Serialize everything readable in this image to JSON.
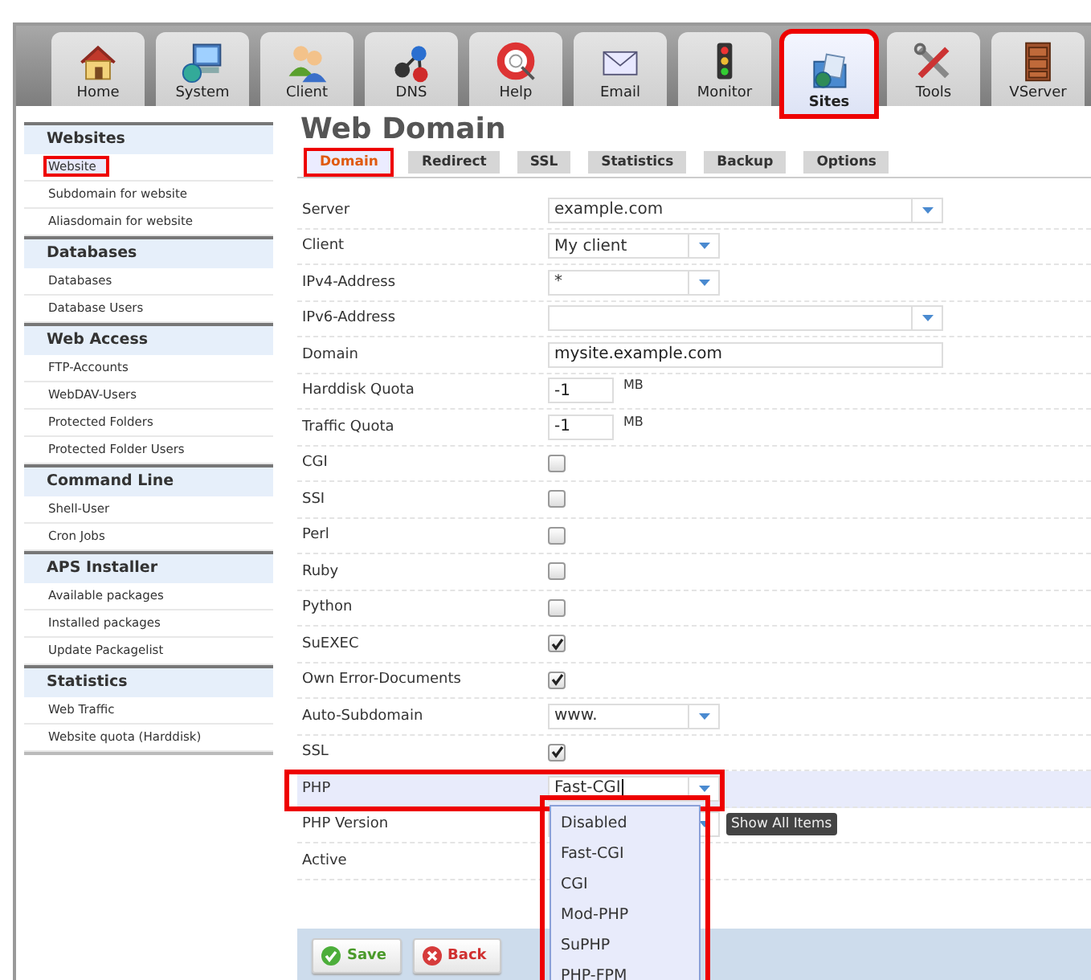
{
  "nav": [
    {
      "label": "Home",
      "selected": false,
      "highlighted": false
    },
    {
      "label": "System",
      "selected": false,
      "highlighted": false
    },
    {
      "label": "Client",
      "selected": false,
      "highlighted": false
    },
    {
      "label": "DNS",
      "selected": false,
      "highlighted": false
    },
    {
      "label": "Help",
      "selected": false,
      "highlighted": false
    },
    {
      "label": "Email",
      "selected": false,
      "highlighted": false
    },
    {
      "label": "Monitor",
      "selected": false,
      "highlighted": false
    },
    {
      "label": "Sites",
      "selected": true,
      "highlighted": true
    },
    {
      "label": "Tools",
      "selected": false,
      "highlighted": false
    },
    {
      "label": "VServer",
      "selected": false,
      "highlighted": false
    }
  ],
  "sidebar": [
    {
      "title": "Websites",
      "items": [
        {
          "label": "Website",
          "selected": true,
          "highlighted": true
        },
        {
          "label": "Subdomain for website",
          "selected": false,
          "highlighted": false
        },
        {
          "label": "Aliasdomain for website",
          "selected": false,
          "highlighted": false
        }
      ]
    },
    {
      "title": "Databases",
      "items": [
        {
          "label": "Databases",
          "selected": false,
          "highlighted": false
        },
        {
          "label": "Database Users",
          "selected": false,
          "highlighted": false
        }
      ]
    },
    {
      "title": "Web Access",
      "items": [
        {
          "label": "FTP-Accounts",
          "selected": false,
          "highlighted": false
        },
        {
          "label": "WebDAV-Users",
          "selected": false,
          "highlighted": false
        },
        {
          "label": "Protected Folders",
          "selected": false,
          "highlighted": false
        },
        {
          "label": "Protected Folder Users",
          "selected": false,
          "highlighted": false
        }
      ]
    },
    {
      "title": "Command Line",
      "items": [
        {
          "label": "Shell-User",
          "selected": false,
          "highlighted": false
        },
        {
          "label": "Cron Jobs",
          "selected": false,
          "highlighted": false
        }
      ]
    },
    {
      "title": "APS Installer",
      "items": [
        {
          "label": "Available packages",
          "selected": false,
          "highlighted": false
        },
        {
          "label": "Installed packages",
          "selected": false,
          "highlighted": false
        },
        {
          "label": "Update Packagelist",
          "selected": false,
          "highlighted": false
        }
      ]
    },
    {
      "title": "Statistics",
      "items": [
        {
          "label": "Web Traffic",
          "selected": false,
          "highlighted": false
        },
        {
          "label": "Website quota (Harddisk)",
          "selected": false,
          "highlighted": false
        }
      ]
    }
  ],
  "page_title": "Web Domain",
  "tabs": [
    {
      "label": "Domain",
      "selected": true,
      "highlighted": true
    },
    {
      "label": "Redirect",
      "selected": false,
      "highlighted": false
    },
    {
      "label": "SSL",
      "selected": false,
      "highlighted": false
    },
    {
      "label": "Statistics",
      "selected": false,
      "highlighted": false
    },
    {
      "label": "Backup",
      "selected": false,
      "highlighted": false
    },
    {
      "label": "Options",
      "selected": false,
      "highlighted": false
    }
  ],
  "fields": [
    {
      "label": "Server",
      "kind": "wide-select",
      "value": "example.com"
    },
    {
      "label": "Client",
      "kind": "select",
      "value": "My client"
    },
    {
      "label": "IPv4-Address",
      "kind": "select",
      "value": "*"
    },
    {
      "label": "IPv6-Address",
      "kind": "wide-select"
    },
    {
      "label": "Domain",
      "kind": "text",
      "value": "mysite.example.com"
    },
    {
      "label": "Harddisk Quota",
      "kind": "number",
      "value": "-1",
      "unit": "MB"
    },
    {
      "label": "Traffic Quota",
      "kind": "number",
      "value": "-1",
      "unit": "MB"
    },
    {
      "label": "CGI",
      "kind": "checkbox",
      "checked": false
    },
    {
      "label": "SSI",
      "kind": "checkbox",
      "checked": false
    },
    {
      "label": "Perl",
      "kind": "checkbox",
      "checked": false
    },
    {
      "label": "Ruby",
      "kind": "checkbox",
      "checked": false
    },
    {
      "label": "Python",
      "kind": "checkbox",
      "checked": false
    },
    {
      "label": "SuEXEC",
      "kind": "checkbox",
      "checked": true
    },
    {
      "label": "Own Error-Documents",
      "kind": "checkbox",
      "checked": true
    },
    {
      "label": "Auto-Subdomain",
      "kind": "select",
      "value": "www."
    },
    {
      "label": "SSL",
      "kind": "checkbox",
      "checked": true
    },
    {
      "label": "PHP",
      "kind": "combo",
      "value": "Fast-CGI",
      "highlighted": true,
      "expanded": true,
      "options": [
        "Disabled",
        "Fast-CGI",
        "CGI",
        "Mod-PHP",
        "SuPHP",
        "PHP-FPM"
      ]
    },
    {
      "label": "PHP Version",
      "kind": "select",
      "tooltip": "Show All Items"
    },
    {
      "label": "Active",
      "kind": "label"
    }
  ],
  "buttons": [
    {
      "label": "Save",
      "kind": "save"
    },
    {
      "label": "Back",
      "kind": "back"
    }
  ]
}
